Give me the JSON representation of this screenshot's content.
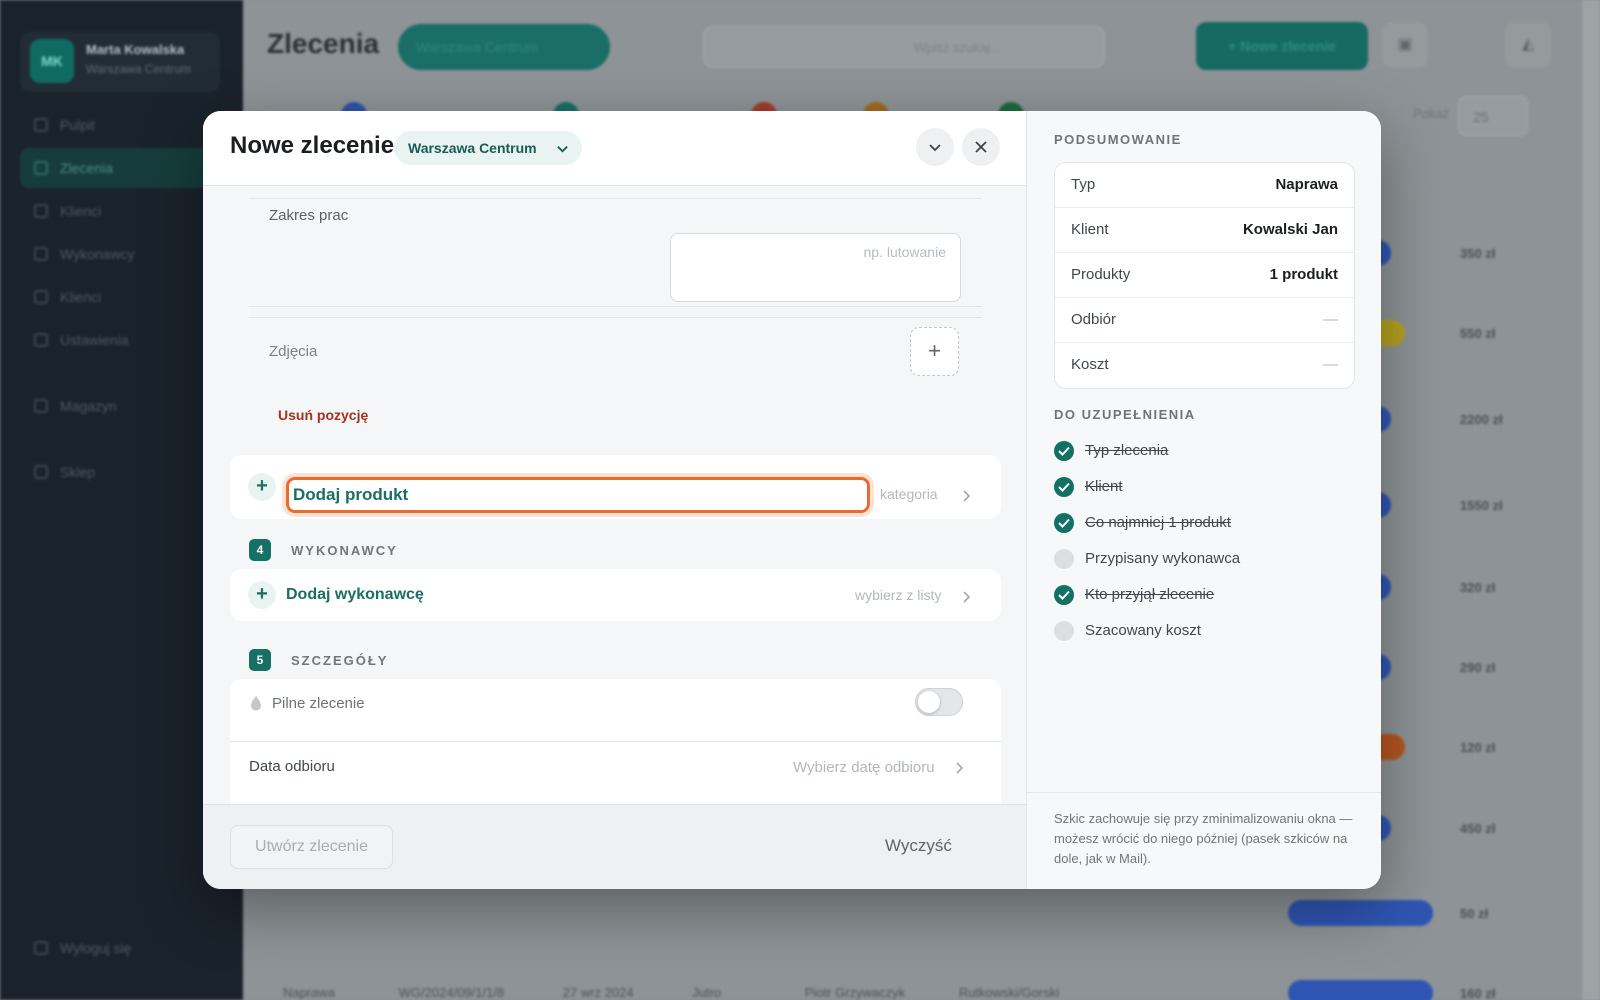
{
  "background": {
    "sidebar": {
      "user_initials": "MK",
      "user_name": "Marta Kowalska",
      "user_role": "Warszawa Centrum",
      "nav": [
        "Pulpit",
        "Zlecenia",
        "Klienci",
        "Wykonawcy",
        "Klienci",
        "Ustawienia",
        "Magazyn",
        "Sklep"
      ],
      "footer": "Wyloguj się"
    },
    "title": "Zlecenia",
    "branch": "Warszawa Centrum",
    "search_placeholder": "Wpisz szukaj...",
    "new_order": "+ Nowe zlecenie",
    "count_label": "Pokaż",
    "count_value": "25",
    "prices": [
      "350 zł",
      "550 zł",
      "2200 zł",
      "1550 zł",
      "320 zł",
      "290 zł",
      "120 zł",
      "450 zł",
      "50 zł",
      "160 zł"
    ],
    "row_type": "Naprawa",
    "row_id": "WG/2024/09/1/1/8",
    "row_date": "27 wrz 2024",
    "row_status": "Jutro",
    "row_person": "Piotr Grzywaczyk",
    "row_tech": "Rutkowski/Gorski"
  },
  "modal": {
    "title": "Nowe zlecenie",
    "branch": "Warszawa Centrum",
    "scope_label": "Zakres prac",
    "scope_placeholder": "np. lutowanie",
    "photos_label": "Zdjęcia",
    "remove_position": "Usuń pozycję",
    "add_product": "Dodaj produkt",
    "add_product_hint": "kategoria",
    "section4_num": "4",
    "section4_title": "WYKONAWCY",
    "add_executor": "Dodaj wykonawcę",
    "add_executor_hint": "wybierz z listy",
    "section5_num": "5",
    "section5_title": "SZCZEGÓŁY",
    "urgent_label": "Pilne zlecenie",
    "urgent_on": false,
    "pickup_label": "Data odbioru",
    "pickup_hint": "Wybierz datę odbioru",
    "create_button": "Utwórz zlecenie",
    "clear_button": "Wyczyść"
  },
  "summary": {
    "heading": "PODSUMOWANIE",
    "rows": [
      {
        "key": "Typ",
        "value": "Naprawa"
      },
      {
        "key": "Klient",
        "value": "Kowalski Jan"
      },
      {
        "key": "Produkty",
        "value": "1 produkt"
      },
      {
        "key": "Odbiór",
        "value": "—"
      },
      {
        "key": "Koszt",
        "value": "—"
      }
    ],
    "todo_heading": "DO UZUPEŁNIENIA",
    "todo": [
      {
        "label": "Typ zlecenia",
        "done": true
      },
      {
        "label": "Klient",
        "done": true
      },
      {
        "label": "Co najmniej 1 produkt",
        "done": true
      },
      {
        "label": "Przypisany wykonawca",
        "done": false
      },
      {
        "label": "Kto przyjął zlecenie",
        "done": true
      },
      {
        "label": "Szacowany koszt",
        "done": false
      }
    ],
    "note": "Szkic zachowuje się przy zminimalizowaniu okna — możesz wrócić do niego później (pasek szkiców na dole, jak w Mail)."
  },
  "colors": {
    "accent": "#167066",
    "focus_ring": "#ee6a2c",
    "danger": "#a33321"
  }
}
